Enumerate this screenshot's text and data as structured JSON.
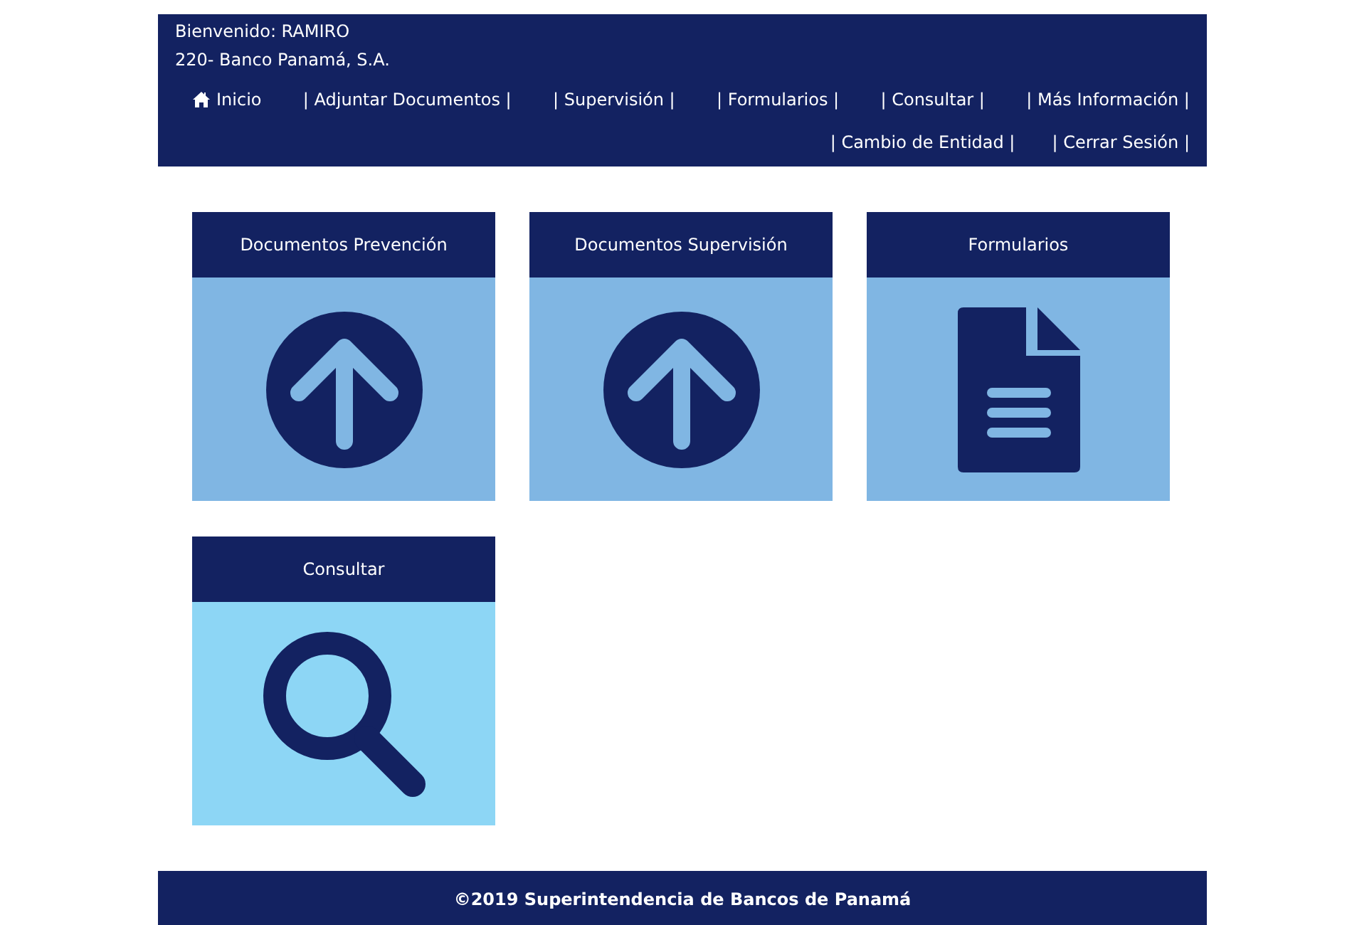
{
  "header": {
    "welcome": "Bienvenido: RAMIRO",
    "entity": "220- Banco Panamá, S.A.",
    "nav_rows": [
      [
        {
          "label": "Inicio",
          "kind": "home"
        },
        {
          "label": "| Adjuntar Documentos |",
          "kind": "link"
        },
        {
          "label": "| Supervisión |",
          "kind": "link"
        },
        {
          "label": "| Formularios |",
          "kind": "link"
        },
        {
          "label": "| Consultar |",
          "kind": "link"
        },
        {
          "label": "| Más Información |",
          "kind": "link"
        }
      ],
      [
        {
          "label": "| Cambio de Entidad |",
          "kind": "link"
        },
        {
          "label": "| Cerrar Sesión |",
          "kind": "link"
        }
      ]
    ]
  },
  "tiles": [
    {
      "title": "Documentos Prevención",
      "kind": "upload",
      "color": "#80b6e3"
    },
    {
      "title": "Documentos Supervisión",
      "kind": "upload",
      "color": "#80b6e3"
    },
    {
      "title": "Formularios",
      "kind": "document",
      "color": "#80b6e3"
    },
    {
      "title": "Consultar",
      "kind": "search",
      "color": "#8dd6f5"
    }
  ],
  "footer": "©2019 Superintendencia de Bancos de Panamá"
}
